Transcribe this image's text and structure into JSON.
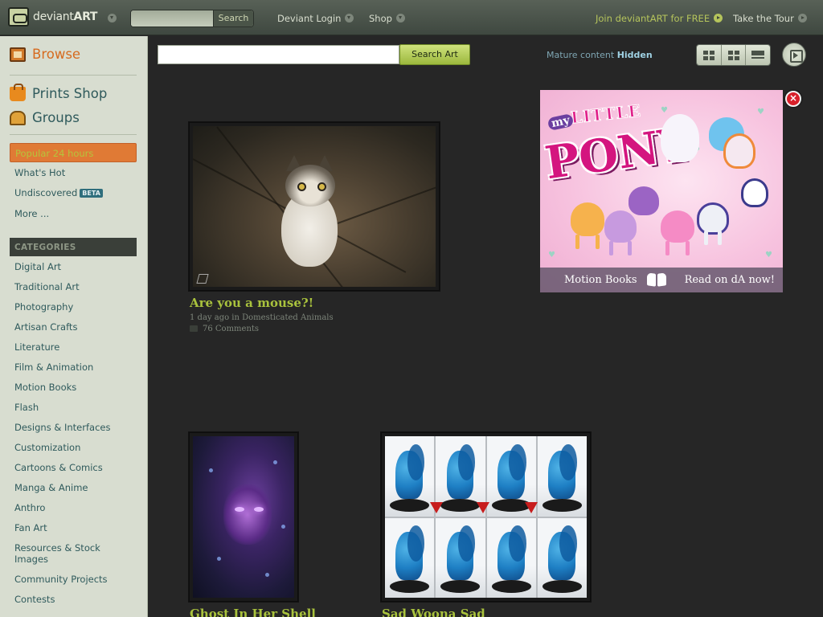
{
  "header": {
    "logo_text": "deviant",
    "logo_text_bold": "ART",
    "search_placeholder": "",
    "search_button": "Search",
    "deviant_login": "Deviant Login",
    "shop": "Shop",
    "join": "Join deviantART for FREE",
    "tour": "Take the Tour"
  },
  "sidebar": {
    "browse": "Browse",
    "prints_shop": "Prints Shop",
    "groups": "Groups",
    "popular": "Popular 24 hours",
    "whats_hot": "What's Hot",
    "undiscovered": "Undiscovered",
    "beta": "BETA",
    "more": "More ...",
    "categories_header": "CATEGORIES",
    "categories": [
      "Digital Art",
      "Traditional Art",
      "Photography",
      "Artisan Crafts",
      "Literature",
      "Film & Animation",
      "Motion Books",
      "Flash",
      "Designs & Interfaces",
      "Customization",
      "Cartoons & Comics",
      "Manga & Anime",
      "Anthro",
      "Fan Art",
      "Resources & Stock Images",
      "Community Projects",
      "Contests"
    ]
  },
  "main": {
    "search_placeholder": "",
    "search_button": "Search Art",
    "mature_label": "Mature content",
    "mature_state": "Hidden",
    "view_icons": [
      "grid-small-icon",
      "grid-large-icon",
      "list-view-icon"
    ],
    "slideshow_icon": "slideshow-play-icon"
  },
  "artworks": [
    {
      "title": "Are you a mouse?!",
      "age": "1 day ago in",
      "category": "Domesticated Animals",
      "comments": "76 Comments"
    },
    {
      "title": "Ghost In Her Shell"
    },
    {
      "title": "Sad Woona Sad"
    }
  ],
  "ad": {
    "logo_my": "my",
    "logo_little": "LITTLE",
    "logo_pony": "PONY",
    "banner_left": "Motion Books",
    "banner_right": "Read on dA now!",
    "close": "×"
  },
  "colors": {
    "accent_green": "#a9c23d",
    "popular_orange": "#e07a35",
    "link_teal": "#2f5a5c"
  }
}
